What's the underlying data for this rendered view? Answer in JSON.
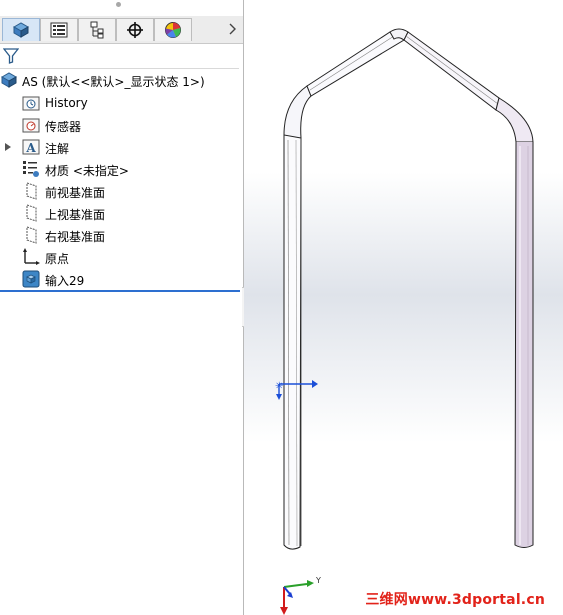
{
  "tabs": [
    {
      "name": "feature-manager",
      "icon": "feature-tree-icon",
      "active": true
    },
    {
      "name": "property-manager",
      "icon": "property-list-icon",
      "active": false
    },
    {
      "name": "configuration-manager",
      "icon": "configuration-icon",
      "active": false
    },
    {
      "name": "dimxpert-manager",
      "icon": "crosshair-icon",
      "active": false
    },
    {
      "name": "display-manager",
      "icon": "appearance-pie-icon",
      "active": false
    }
  ],
  "tree": {
    "root_label": "AS  (默认<<默认>_显示状态 1>)",
    "items": [
      {
        "label": "History",
        "icon": "history-folder-icon"
      },
      {
        "label": "传感器",
        "icon": "sensor-folder-icon"
      },
      {
        "label": "注解",
        "icon": "annotation-icon"
      },
      {
        "label": "材质 <未指定>",
        "icon": "material-icon"
      },
      {
        "label": "前视基准面",
        "icon": "plane-icon"
      },
      {
        "label": "上视基准面",
        "icon": "plane-icon"
      },
      {
        "label": "右视基准面",
        "icon": "plane-icon"
      },
      {
        "label": "原点",
        "icon": "origin-icon"
      },
      {
        "label": "输入29",
        "icon": "imported-body-icon"
      }
    ]
  },
  "triad": {
    "y_label": "Y"
  },
  "watermark": "三维网www.3dportal.cn",
  "colors": {
    "accent": "#2d6fd0",
    "watermark": "#e2231a",
    "tube_shade": "#d9cfe0"
  }
}
